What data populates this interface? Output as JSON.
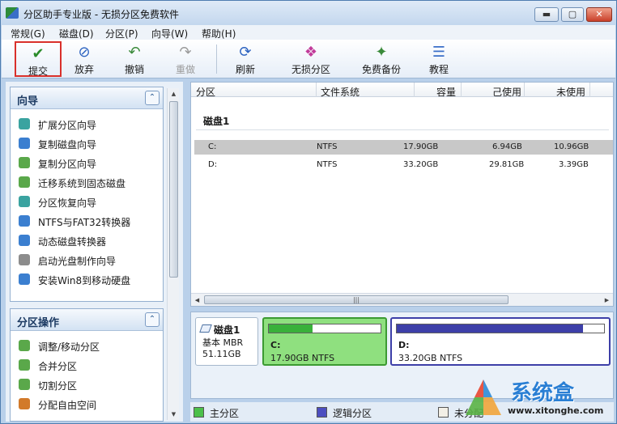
{
  "window": {
    "title": "分区助手专业版 - 无损分区免费软件",
    "controls": {
      "minimize": "▬",
      "restore": "▢",
      "close": "✕"
    }
  },
  "menu": [
    "常规(G)",
    "磁盘(D)",
    "分区(P)",
    "向导(W)",
    "帮助(H)"
  ],
  "toolbar": [
    {
      "label": "提交",
      "icon": "✔",
      "color": "#2a8c2a"
    },
    {
      "label": "放弃",
      "icon": "⊘",
      "color": "#2b62c0"
    },
    {
      "label": "撤销",
      "icon": "↶",
      "color": "#3a8a3a"
    },
    {
      "label": "重做",
      "icon": "↷",
      "color": "#9a9a9a"
    },
    {
      "label": "刷新",
      "icon": "⟳",
      "color": "#2b62c0"
    },
    {
      "label": "无损分区",
      "icon": "❖",
      "color": "#c23b9a"
    },
    {
      "label": "免费备份",
      "icon": "✦",
      "color": "#3a8a3a"
    },
    {
      "label": "教程",
      "icon": "☰",
      "color": "#3b6fc8"
    }
  ],
  "wizard_panel": {
    "title": "向导",
    "collapse": "⌃",
    "items": [
      {
        "label": "扩展分区向导",
        "color": "#3aa3a0"
      },
      {
        "label": "复制磁盘向导",
        "color": "#3b7fd0"
      },
      {
        "label": "复制分区向导",
        "color": "#5aa84a"
      },
      {
        "label": "迁移系统到固态磁盘",
        "color": "#5aa84a"
      },
      {
        "label": "分区恢复向导",
        "color": "#3aa3a0"
      },
      {
        "label": "NTFS与FAT32转换器",
        "color": "#3b7fd0"
      },
      {
        "label": "动态磁盘转换器",
        "color": "#3b7fd0"
      },
      {
        "label": "启动光盘制作向导",
        "color": "#8c8c8c"
      },
      {
        "label": "安装Win8到移动硬盘",
        "color": "#3b7fd0"
      }
    ]
  },
  "partition_ops_panel": {
    "title": "分区操作",
    "collapse": "⌃",
    "items": [
      {
        "label": "调整/移动分区",
        "color": "#5aa84a"
      },
      {
        "label": "合并分区",
        "color": "#5aa84a"
      },
      {
        "label": "切割分区",
        "color": "#5aa84a"
      },
      {
        "label": "分配自由空间",
        "color": "#d27a2a"
      }
    ]
  },
  "table": {
    "columns": [
      "分区",
      "文件系统",
      "容量",
      "己使用",
      "未使用"
    ],
    "disk_label": "磁盘1",
    "rows": [
      {
        "partition": "C:",
        "fs": "NTFS",
        "capacity": "17.90GB",
        "used": "6.94GB",
        "free": "10.96GB"
      },
      {
        "partition": "D:",
        "fs": "NTFS",
        "capacity": "33.20GB",
        "used": "29.81GB",
        "free": "3.39GB"
      }
    ],
    "hscroll_grip": "|||"
  },
  "disk_map": {
    "disk": {
      "name": "磁盘1",
      "type": "基本 MBR",
      "size": "51.11GB"
    },
    "partitions": [
      {
        "name": "C:",
        "desc": "17.90GB NTFS",
        "used_fraction": 0.39,
        "fill": "#39b13a",
        "bg": "#8fe07f",
        "border": "#3c9a32"
      },
      {
        "name": "D:",
        "desc": "33.20GB NTFS",
        "used_fraction": 0.9,
        "fill": "#3d3fa8",
        "bg": "#ffffff",
        "border": "#3d3fa8"
      }
    ]
  },
  "legend": [
    {
      "label": "主分区",
      "color": "#4cc04a"
    },
    {
      "label": "逻辑分区",
      "color": "#4d4fc0"
    },
    {
      "label": "未分配",
      "color": "#f2efe6"
    }
  ],
  "watermark": {
    "cn": "系统盒",
    "url": "www.xitonghe.com"
  },
  "colors": {
    "accent": "#2b62c0",
    "highlight_border": "#d9302b",
    "selected_row": "#c8c8c8"
  }
}
